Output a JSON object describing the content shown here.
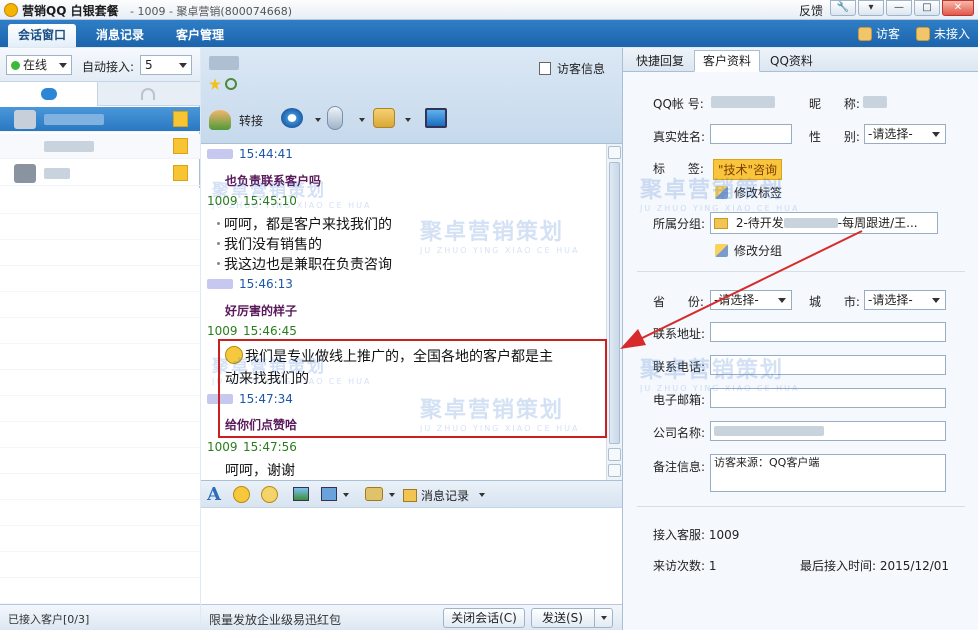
{
  "titlebar": {
    "app": "营销QQ 白银套餐",
    "subtitle": "- 1009 - 聚卓营销(800074668)",
    "feedback": "反馈",
    "buttons": {
      "tools": "🔧",
      "menu": "▾",
      "minimize": "—",
      "maximize": "□",
      "close": "✕"
    }
  },
  "main_tabs": [
    {
      "label": "会话窗口",
      "active": true
    },
    {
      "label": "消息记录",
      "active": false
    },
    {
      "label": "客户管理",
      "active": false
    }
  ],
  "top_right": {
    "visitor": "访客",
    "not_accept": "未接入"
  },
  "left": {
    "status": "在线",
    "auto_accept_label": "自动接入:",
    "auto_accept_value": "5",
    "footer": "已接入客户[0/3]"
  },
  "center": {
    "visitor_info": "访客信息",
    "transfer": "转接",
    "messages": [
      {
        "kind": "other",
        "time": "15:44:41",
        "text": "也负责联系客户吗"
      },
      {
        "kind": "self",
        "sender": "1009",
        "time": "15:45:10",
        "lines": [
          "呵呵，都是客户来找我们的",
          "我们没有销售的",
          "我这边也是兼职在负责咨询"
        ]
      },
      {
        "kind": "other",
        "time": "15:46:13",
        "text": "好厉害的样子"
      },
      {
        "kind": "self",
        "sender": "1009",
        "time": "15:46:45",
        "lines": [
          "我们是专业做线上推广的，全国各地的客户都是主",
          "动来找我们的"
        ]
      },
      {
        "kind": "other",
        "time": "15:47:34",
        "text": "给你们点赞哈"
      },
      {
        "kind": "self",
        "sender": "1009",
        "time": "15:47:56",
        "lines": [
          "呵呵，谢谢"
        ]
      }
    ],
    "toolbar_history": "消息记录",
    "footer_promo": "限量发放企业级易迅红包",
    "close_button": "关闭会话(C)",
    "send_button": "发送(S)"
  },
  "right": {
    "tabs": [
      {
        "label": "快捷回复",
        "active": false
      },
      {
        "label": "客户资料",
        "active": true
      },
      {
        "label": "QQ资料",
        "active": false
      }
    ],
    "qq_label": "QQ帐  号:",
    "nick_label": "昵      称:",
    "realname_label": "真实姓名:",
    "gender_label": "性      别:",
    "gender_value": "-请选择-",
    "tag_label": "标      签:",
    "tag_value": "\"技术\"咨询",
    "edit_tag": "修改标签",
    "group_label": "所属分组:",
    "group_value_start": "2-待开发",
    "group_value_end": "-每周跟进/王...",
    "edit_group": "修改分组",
    "province_label": "省      份:",
    "province_value": "-请选择-",
    "city_label": "城      市:",
    "city_value": "-请选择-",
    "address_label": "联系地址:",
    "phone_label": "联系电话:",
    "email_label": "电子邮箱:",
    "company_label": "公司名称:",
    "remark_label": "备注信息:",
    "remark_value": "访客来源：QQ客户端",
    "agent_label": "接入客服: 1009",
    "visits_label": "来访次数: 1",
    "last_visit_label": "最后接入时间: 2015/12/01"
  },
  "watermark": {
    "cn": "聚卓营销策划",
    "en": "JU ZHUO YING XIAO CE HUA"
  },
  "colors": {
    "accent": "#1c64ab",
    "highlight": "#cc1f1f",
    "tag": "#f8c53c"
  }
}
